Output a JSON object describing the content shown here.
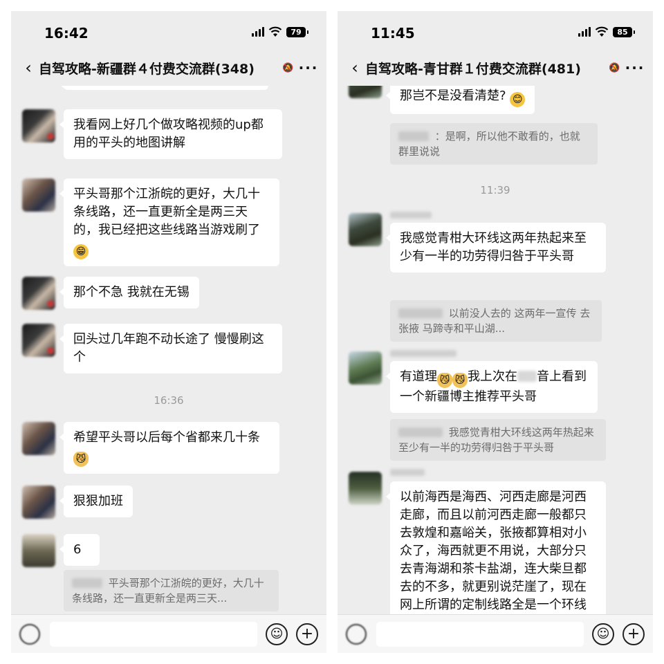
{
  "left": {
    "status_bar": {
      "time": "16:42",
      "battery": "79"
    },
    "title_bar": {
      "title": "自驾攻略-新疆群４付费交流群(348)"
    },
    "messages": [
      {
        "text": "我看网上好几个做攻略视频的up都用的平头的地图讲解"
      },
      {
        "text": "平头哥那个江浙皖的更好，大几十条线路，还一直更新全是两三天的，我已经把这些线路当游戏刷了"
      },
      {
        "text": "那个不急 我就在无锡"
      },
      {
        "text": "回头过几年跑不动长途了 慢慢刷这个"
      },
      {
        "text": "希望平头哥以后每个省都来几十条"
      },
      {
        "text": "狠狠加班"
      },
      {
        "text": "6"
      }
    ],
    "timestamp": "16:36",
    "quote": {
      "text": "平头哥那个江浙皖的更好，大几十条线路，还一直更新全是两三天..."
    }
  },
  "right": {
    "status_bar": {
      "time": "11:45",
      "battery": "85"
    },
    "title_bar": {
      "title": "自驾攻略-青甘群１付费交流群(481)"
    },
    "timestamp": "11:39",
    "messages": [
      {
        "text": "那岂不是没看清楚?"
      },
      {
        "text": "我感觉青柑大环线这两年热起来至少有一半的功劳得归咎于平头哥"
      },
      {
        "text_a": "有道理",
        "text_b": "我上次在",
        "text_c": "音上看到一个新疆博主推荐平头哥"
      },
      {
        "text": "以前海西是海西、河西走廊是河西走廊，而且以前河西走廊一般都只去敦煌和嘉峪关，张掖都算相对小众了，海西就更不用说，大部分只去青海湖和茶卡盐湖，连大柴旦都去的不多，就更别说茫崖了，现在网上所谓的定制线路全是一个环线一起玩了"
      }
    ],
    "quotes": [
      {
        "text": "：是啊，所以他不敢看的，也就群里说说"
      },
      {
        "text": "以前没人去的 这两年一宣传 去张掖 马蹄寺和平山湖..."
      },
      {
        "text": "我感觉青柑大环线这两年热起来至少有一半的功劳得归咎于平头哥"
      }
    ]
  },
  "icons": {
    "back": "‹",
    "more": "···",
    "mute": "🔕",
    "emoji_button": "☺",
    "plus_button": "+",
    "grin_emoji": "😁",
    "cat_emoji": "😼",
    "smile_emoji": "😊"
  },
  "colors": {
    "chat_background": "#ededed",
    "bubble": "#ffffff",
    "quote": "#e2e2e2"
  }
}
